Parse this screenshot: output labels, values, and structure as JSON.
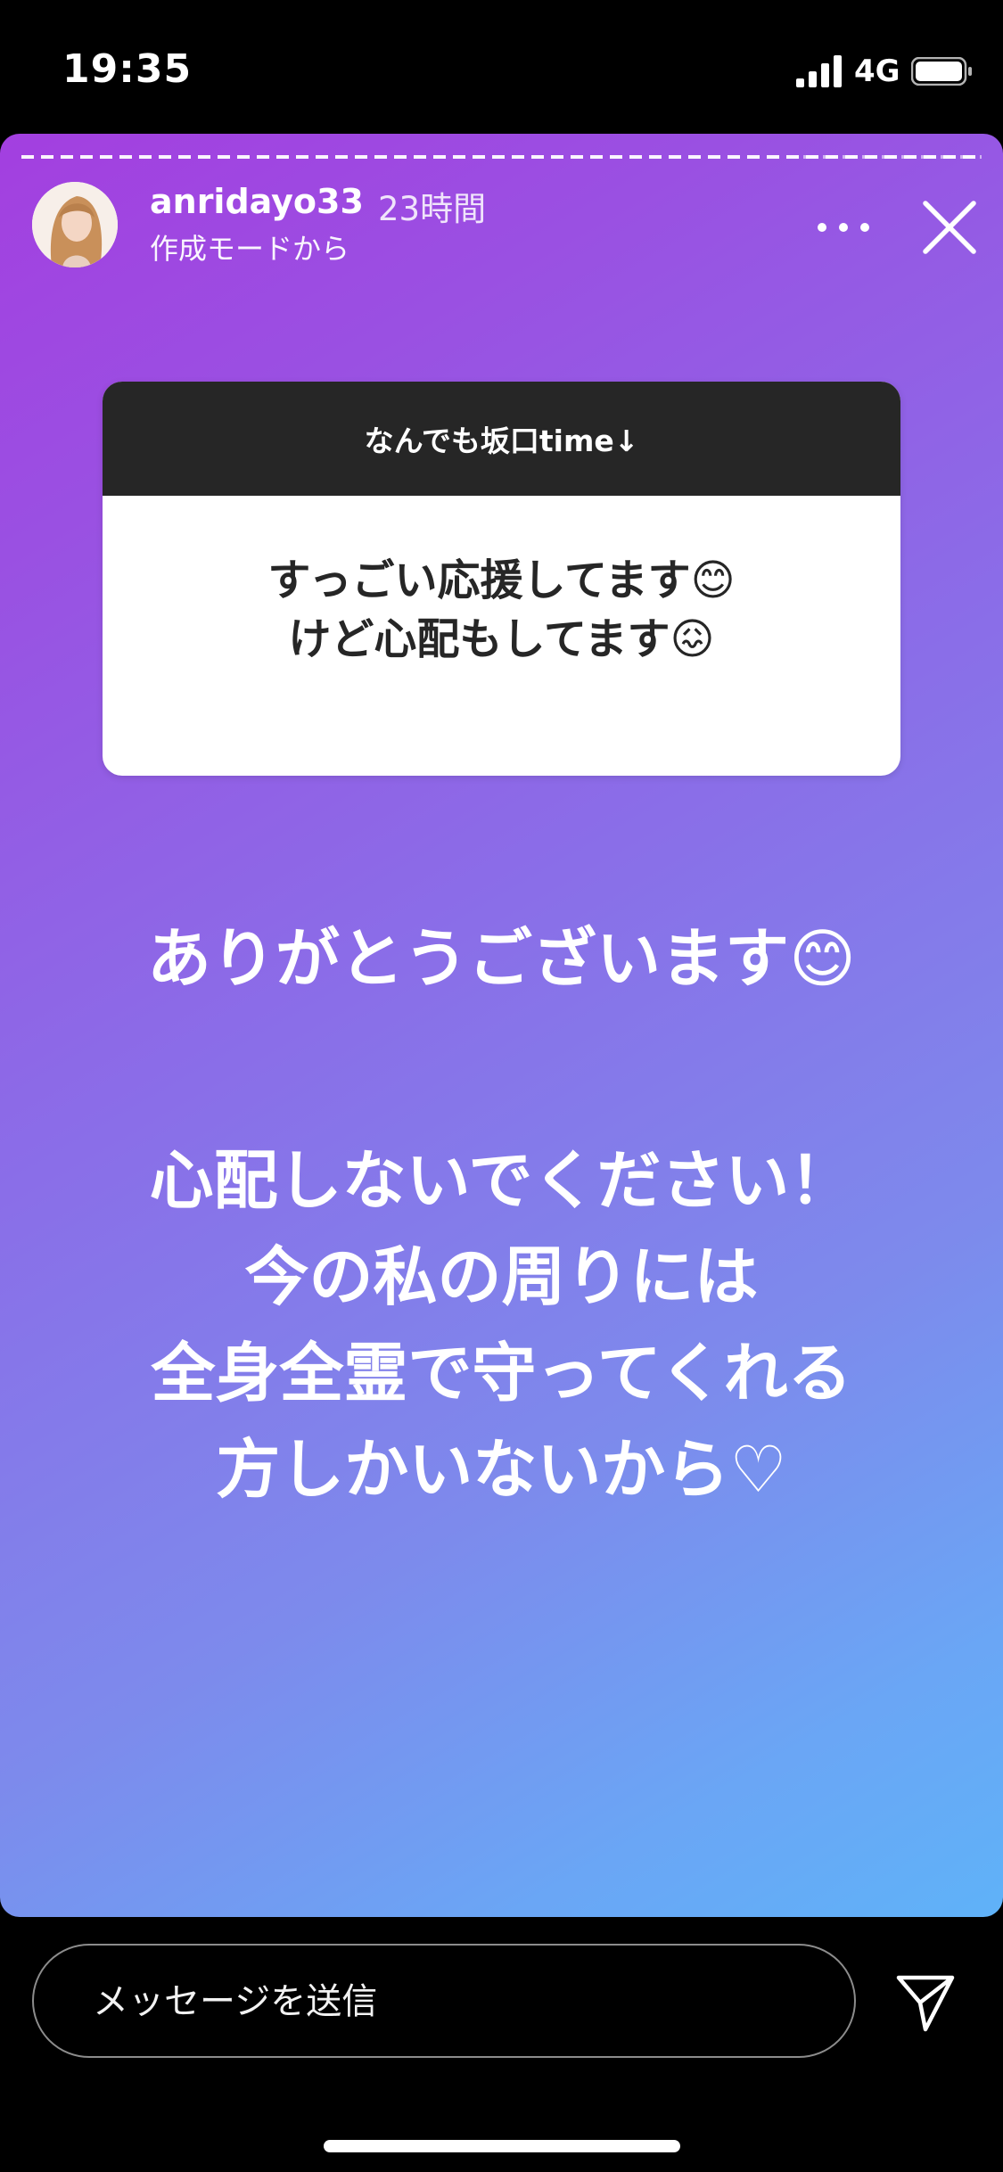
{
  "status_bar": {
    "time": "19:35",
    "network": "4G",
    "icons": [
      "signal-icon",
      "battery-icon"
    ]
  },
  "story": {
    "username": "anridayo33",
    "timestamp": "23時間",
    "subtitle": "作成モードから",
    "question_box": {
      "header": "なんでも坂口time↓",
      "lines": [
        "すっごい応援してます😊",
        "けど心配もしてます😖"
      ]
    },
    "answer": {
      "line1": "ありがとうございます😊",
      "line2": "心配しないでください！",
      "line3": "今の私の周りには",
      "line4": "全身全霊で守ってくれる",
      "line5": "方しかいないから♡"
    },
    "colors": {
      "gradient_start": "#a33fe0",
      "gradient_end": "#5fb2f8",
      "question_header_bg": "#262626"
    }
  },
  "message_bar": {
    "placeholder": "メッセージを送信"
  }
}
